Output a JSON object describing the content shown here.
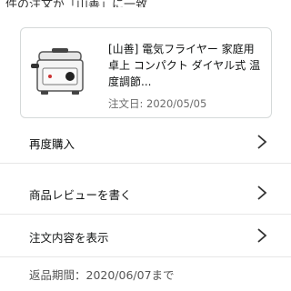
{
  "top_text": "件の注文が「山善」に一致",
  "order": {
    "title": "[山善] 電気フライヤー 家庭用 卓上 コンパクト ダイヤル式 温度調節...",
    "date_text": "注文日: 2020/05/05",
    "image_alt": "electric-fryer-product-image"
  },
  "actions": [
    {
      "label": "再度購入"
    },
    {
      "label": "商品レビューを書く"
    },
    {
      "label": "注文内容を表示"
    }
  ],
  "return_text": "返品期間：2020/06/07まで",
  "colors": {
    "text": "#0f1111",
    "muted": "#6b6b6b",
    "border": "#d5d9d9",
    "chevron": "#333333"
  },
  "icons": {
    "row_chevron": "chevron-right-icon"
  }
}
